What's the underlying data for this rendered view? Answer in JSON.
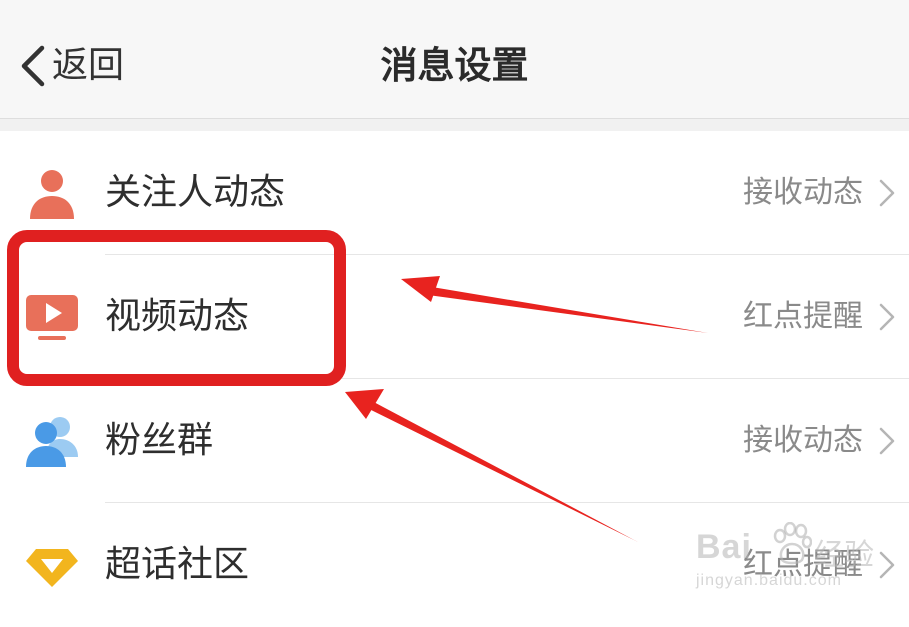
{
  "navbar": {
    "back_label": "返回",
    "title": "消息设置"
  },
  "rows": [
    {
      "label": "关注人动态",
      "value": "接收动态",
      "icon": "person-icon",
      "icon_color": "#e8705a"
    },
    {
      "label": "视频动态",
      "value": "红点提醒",
      "icon": "video-play-icon",
      "icon_color": "#e8705a"
    },
    {
      "label": "粉丝群",
      "value": "接收动态",
      "icon": "group-icon",
      "icon_color": "#5aa7e8"
    },
    {
      "label": "超话社区",
      "value": "红点提醒",
      "icon": "diamond-icon",
      "icon_color": "#f2b51e"
    }
  ],
  "annotation": {
    "highlight_color": "#e02020",
    "arrow_color": "#e8231f"
  },
  "watermark": {
    "brand": "Bai",
    "cn": "经验",
    "url": "jingyan.baidu.com"
  }
}
